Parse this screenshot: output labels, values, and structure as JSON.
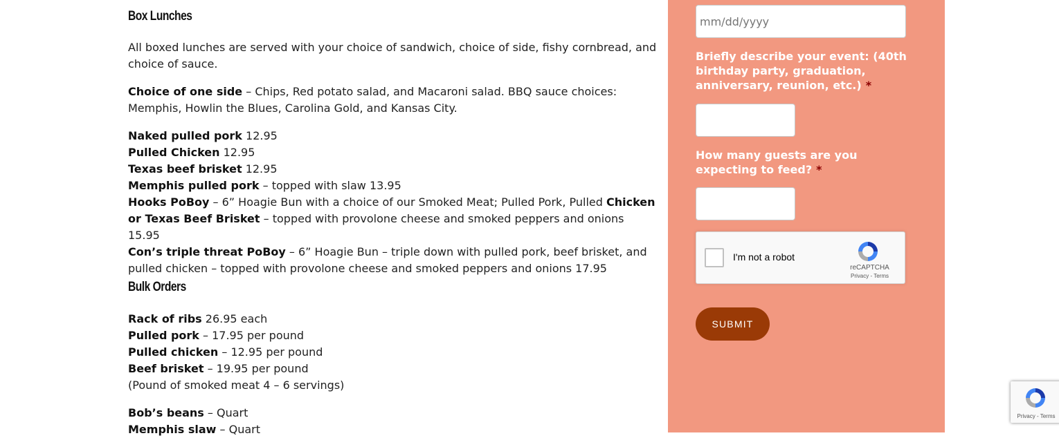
{
  "menu": {
    "box_lunches_heading": "Box Lunches",
    "intro": "All boxed lunches are served with your choice of sandwich, choice of side, fishy cornbread, and choice of sauce.",
    "side_label": "Choice of one side",
    "side_text": " – Chips, Red potato salad, and Macaroni salad. BBQ sauce choices: Memphis, Howlin the Blues, Carolina Gold, and Kansas City.",
    "items": [
      {
        "name": "Naked pulled pork",
        "text": " 12.95"
      },
      {
        "name": "Pulled Chicken",
        "text": " 12.95"
      },
      {
        "name": "Texas beef brisket",
        "text": " 12.95"
      },
      {
        "name": "Memphis pulled pork",
        "text": " – topped with slaw 13.95"
      }
    ],
    "hooks": {
      "name": "Hooks PoBoy",
      "text1": " – 6” Hoagie Bun with a choice of our Smoked Meat; Pulled Pork, Pulled ",
      "bold2": "Chicken or Texas Beef Brisket",
      "text2": " – topped with provolone cheese and smoked peppers and onions 15.95"
    },
    "triple": {
      "name": "Con’s triple threat PoBoy",
      "text": " – 6” Hoagie Bun – triple down with pulled pork, beef brisket, and pulled chicken – topped with provolone cheese and smoked peppers and onions 17.95"
    },
    "bulk_heading": "Bulk Orders",
    "bulk_items": [
      {
        "name": "Rack of ribs",
        "text": " 26.95 each"
      },
      {
        "name": "Pulled pork",
        "text": " – 17.95 per pound"
      },
      {
        "name": "Pulled chicken",
        "text": " – 12.95 per pound"
      },
      {
        "name": "Beef brisket",
        "text": " – 19.95 per pound"
      }
    ],
    "bulk_note": "(Pound of smoked meat 4 – 6 servings)",
    "extras": [
      {
        "name": "Bob’s beans",
        "text": " – Quart"
      },
      {
        "name": "Memphis slaw",
        "text": " – Quart"
      }
    ]
  },
  "form": {
    "date_placeholder": "mm/dd/yyyy",
    "event_label": "Briefly describe your event: (40th birthday party, graduation, anniversary, reunion, etc.)",
    "guests_label": "How many guests are you expecting to feed?",
    "required_mark": "*",
    "recaptcha_text": "I'm not a robot",
    "recaptcha_brand": "reCAPTCHA",
    "recaptcha_links": "Privacy - Terms",
    "submit_label": "SUBMIT"
  },
  "colors": {
    "sidebar": "#f29880",
    "submit": "#9a3a06",
    "required": "#8b0000"
  },
  "badge": {
    "links": "Privacy - Terms"
  }
}
